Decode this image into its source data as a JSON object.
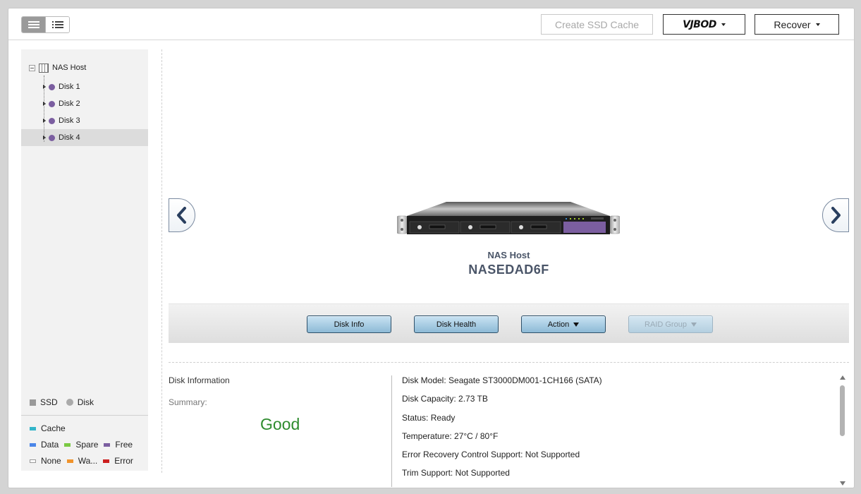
{
  "toolbar": {
    "create_ssd_cache_label": "Create SSD Cache",
    "vjbod_label": "VJBOD",
    "recover_label": "Recover"
  },
  "sidebar": {
    "root_label": "NAS Host",
    "items": [
      {
        "label": "Disk 1",
        "selected": false
      },
      {
        "label": "Disk 2",
        "selected": false
      },
      {
        "label": "Disk 3",
        "selected": false
      },
      {
        "label": "Disk 4",
        "selected": true
      }
    ],
    "legend_types": {
      "ssd": "SSD",
      "disk": "Disk"
    },
    "legend_roles": {
      "cache": {
        "label": "Cache",
        "color": "#33b5c9"
      },
      "data": {
        "label": "Data",
        "color": "#4a86e8"
      },
      "spare": {
        "label": "Spare",
        "color": "#7ac943"
      },
      "free": {
        "label": "Free",
        "color": "#7b5ea0"
      },
      "none": {
        "label": "None",
        "color": "#ffffff"
      },
      "warning": {
        "label": "Wa...",
        "color": "#f0932b"
      },
      "error": {
        "label": "Error",
        "color": "#cc1f1f"
      }
    },
    "disk_dot_color": "#7b5ea0"
  },
  "device": {
    "label": "NAS Host",
    "name": "NASEDAD6F"
  },
  "actions": {
    "disk_info": "Disk Info",
    "disk_health": "Disk Health",
    "action": "Action",
    "raid_group": "RAID Group"
  },
  "info": {
    "title": "Disk Information",
    "summary_label": "Summary:",
    "health": "Good",
    "health_color": "#2e8b2e",
    "details": [
      "Disk Model: Seagate ST3000DM001-1CH166 (SATA)",
      "Disk Capacity: 2.73 TB",
      "Status: Ready",
      "Temperature: 27°C / 80°F",
      "Error Recovery Control Support: Not Supported",
      "Trim Support: Not Supported"
    ]
  }
}
